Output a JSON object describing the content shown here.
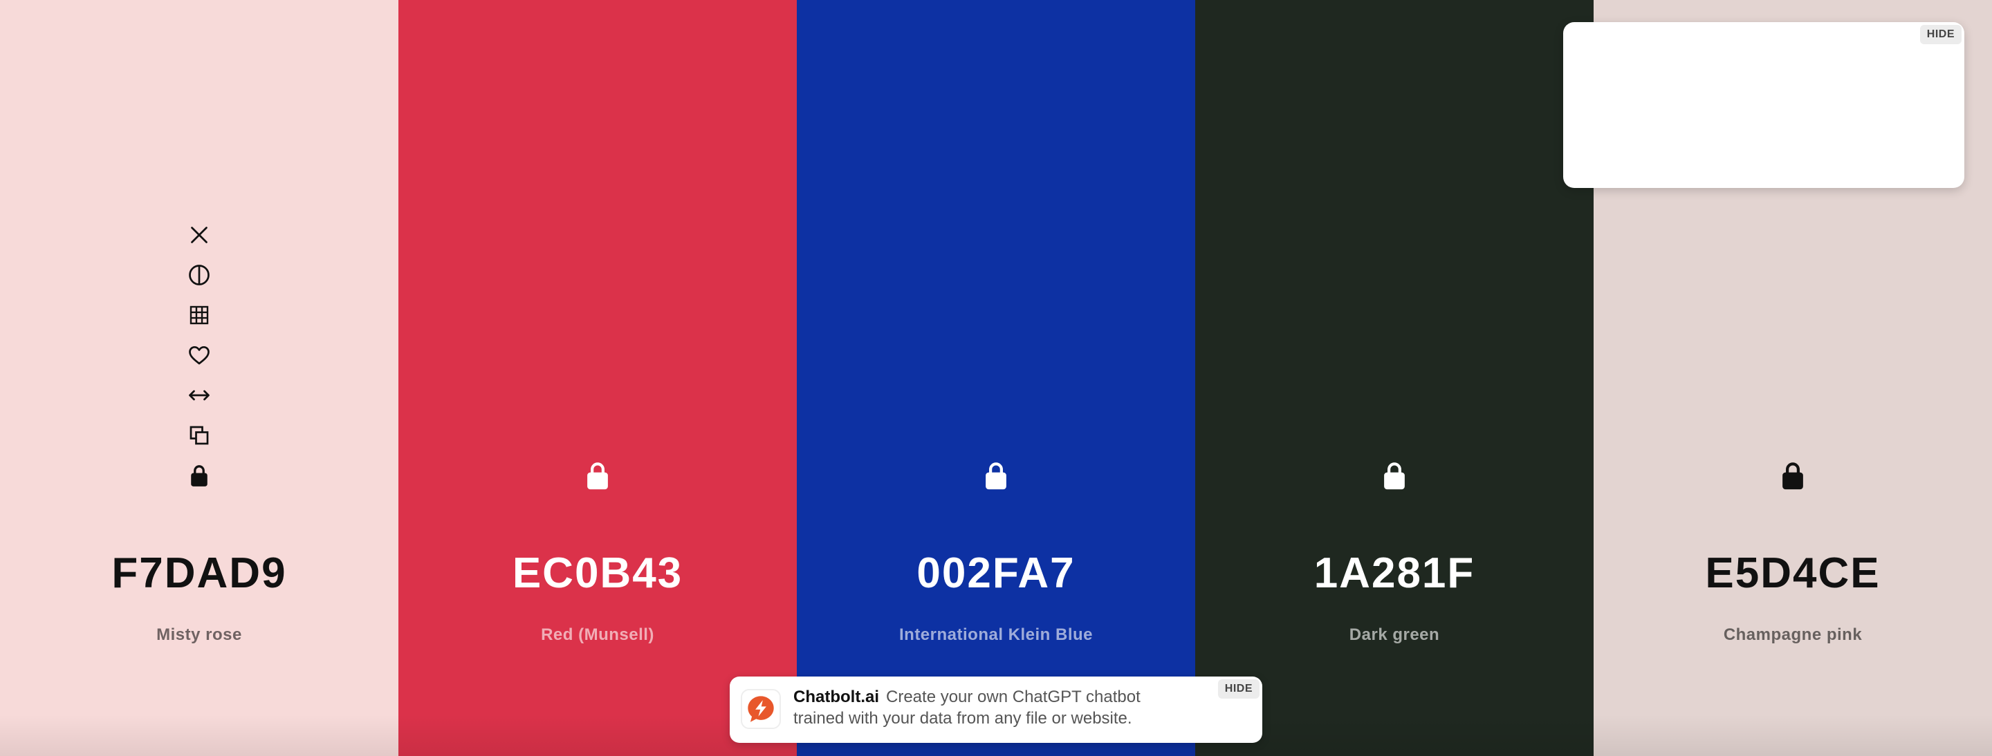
{
  "palette": {
    "swatches": [
      {
        "hex": "F7DAD9",
        "name": "Misty rose",
        "color": "#F7DAD9",
        "tone": "dark",
        "locked": true,
        "tools": [
          "close-icon",
          "contrast-icon",
          "grid-icon",
          "heart-icon",
          "arrows-horizontal-icon",
          "copy-icon",
          "lock-icon"
        ]
      },
      {
        "hex": "EC0B43",
        "name": "Red (Munsell)",
        "color": "#DB324A",
        "tone": "light",
        "locked": true
      },
      {
        "hex": "002FA7",
        "name": "International Klein Blue",
        "color": "#0D31A3",
        "tone": "light",
        "locked": true
      },
      {
        "hex": "1A281F",
        "name": "Dark green",
        "color": "#1F2820",
        "tone": "light",
        "locked": true
      },
      {
        "hex": "E5D4CE",
        "name": "Champagne pink",
        "color": "#E3D4D1",
        "tone": "dark",
        "locked": true
      }
    ]
  },
  "ad_box": {
    "hide_label": "HIDE"
  },
  "banner": {
    "hide_label": "HIDE",
    "brand": "Chatbolt.ai",
    "text": "Create your own ChatGPT chatbot trained with your data from any file or website.",
    "logo_icon": "lightning-chat-icon",
    "logo_color": "#E8572B"
  }
}
